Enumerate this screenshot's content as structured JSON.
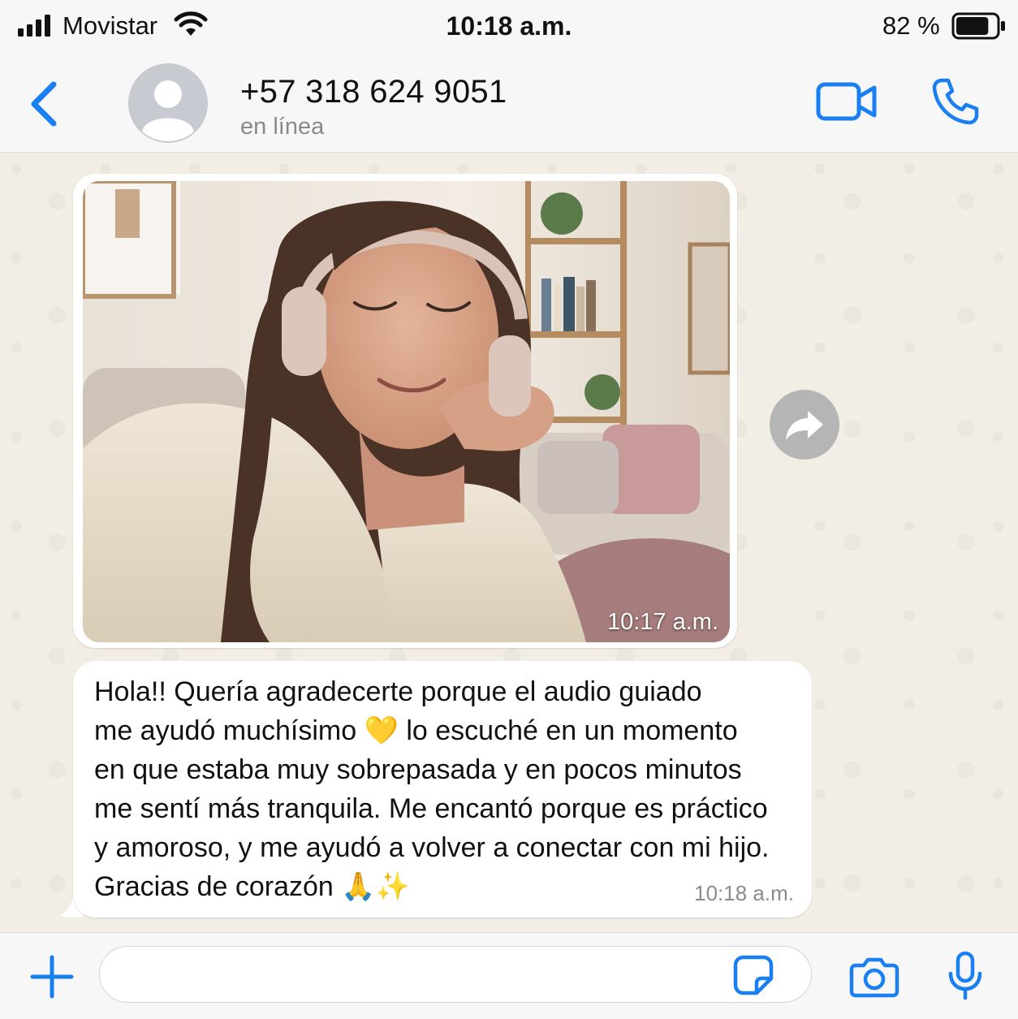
{
  "status_bar": {
    "carrier": "Movistar",
    "time": "10:18 a.m.",
    "battery_percent": "82 %",
    "battery_level": 0.82
  },
  "header": {
    "contact_name": "+57 318 624 9051",
    "contact_status": "en línea",
    "icons": [
      "chevron-left-icon",
      "avatar-placeholder-icon",
      "video-camera-icon",
      "phone-icon"
    ]
  },
  "messages": [
    {
      "type": "image",
      "time": "10:17 a.m."
    },
    {
      "type": "text",
      "text": "Hola!! Quería agradecerte porque el audio guiado\nme ayudó muchísimo 💛 lo escuché en un momento\nen que estaba muy sobrepasada y en pocos minutos\nme sentí más tranquila. Me encantó porque es práctico\ny amoroso, y me ayudó a volver a conectar con mi hijo.\nGracias de corazón 🙏✨",
      "time": "10:18 a.m."
    }
  ],
  "input_bar": {
    "placeholder": "",
    "icons": [
      "plus-icon",
      "sticker-icon",
      "camera-icon",
      "microphone-icon"
    ]
  },
  "colors": {
    "accent": "#1a7ff0",
    "chat_background": "#f2eee6",
    "bubble": "#ffffff",
    "bars": "#f7f7f7"
  }
}
